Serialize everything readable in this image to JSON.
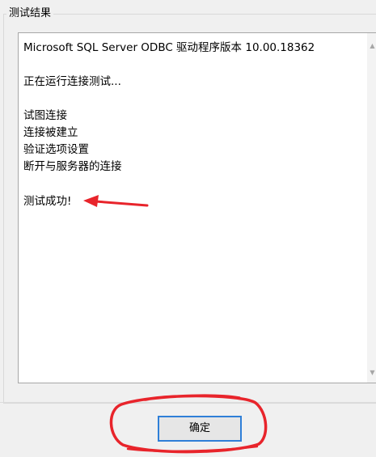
{
  "group": {
    "title": "测试结果"
  },
  "results": {
    "driver_version": "Microsoft SQL Server ODBC 驱动程序版本 10.00.18362",
    "running": "正在运行连接测试...",
    "steps": [
      "试图连接",
      "连接被建立",
      "验证选项设置",
      "断开与服务器的连接"
    ],
    "success": "测试成功!"
  },
  "ok_button": {
    "label": "确定"
  },
  "colors": {
    "annotation": "#e8242b",
    "button_border": "#2f7fd8"
  },
  "icons": {
    "scroll_up": "triangle-up",
    "scroll_down": "triangle-down"
  }
}
